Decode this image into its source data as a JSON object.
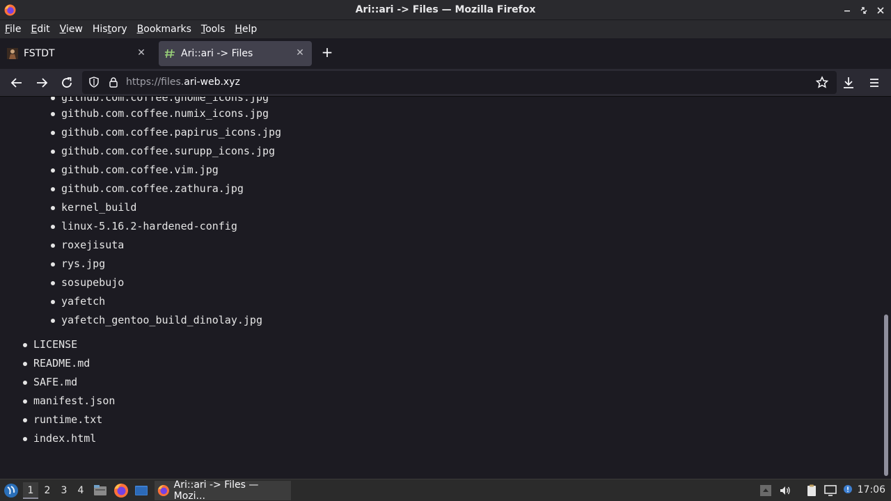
{
  "window": {
    "title": "Ari::ari -> Files — Mozilla Firefox"
  },
  "menubar": {
    "items": [
      {
        "label_first": "F",
        "label_rest": "ile"
      },
      {
        "label_first": "E",
        "label_rest": "dit"
      },
      {
        "label_first": "V",
        "label_rest": "iew"
      },
      {
        "label_first": "His",
        "label_underline": "t",
        "label_rest": "ory"
      },
      {
        "label_first": "B",
        "label_rest": "ookmarks"
      },
      {
        "label_first": "T",
        "label_rest": "ools"
      },
      {
        "label_first": "H",
        "label_rest": "elp"
      }
    ]
  },
  "tabs": [
    {
      "label": "FSTDT",
      "active": false,
      "favicon": "avatar-favicon-icon"
    },
    {
      "label": "Ari::ari -> Files",
      "active": true,
      "favicon": "hash-favicon-icon"
    }
  ],
  "navbar": {
    "url_prefix": "https://files.",
    "url_domain": "ari-web.xyz"
  },
  "content": {
    "nested_items": [
      "github.com.coffee.gnome_icons.jpg",
      "github.com.coffee.numix_icons.jpg",
      "github.com.coffee.papirus_icons.jpg",
      "github.com.coffee.surupp_icons.jpg",
      "github.com.coffee.vim.jpg",
      "github.com.coffee.zathura.jpg",
      "kernel_build",
      "linux-5.16.2-hardened-config",
      "roxejisuta",
      "rys.jpg",
      "sosupebujo",
      "yafetch",
      "yafetch_gentoo_build_dinolay.jpg"
    ],
    "top_items": [
      "LICENSE",
      "README.md",
      "SAFE.md",
      "manifest.json",
      "runtime.txt",
      "index.html"
    ]
  },
  "taskbar": {
    "workspaces": [
      "1",
      "2",
      "3",
      "4"
    ],
    "active_workspace": "1",
    "task_label": "Ari::ari -> Files — Mozi...",
    "clock": "17:06"
  },
  "colors": {
    "accent": "#8f8f9d",
    "background": "#1c1b22",
    "text": "#e6e6e6"
  }
}
